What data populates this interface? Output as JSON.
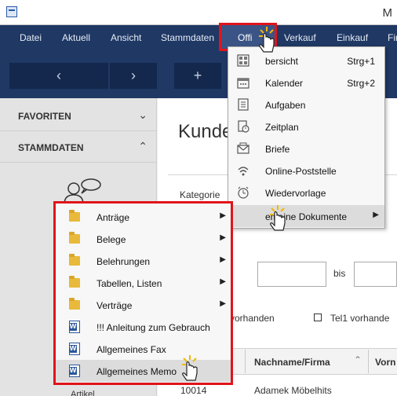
{
  "window": {
    "title": "M"
  },
  "menubar": {
    "items": [
      "Datei",
      "Aktuell",
      "Ansicht",
      "Stammdaten",
      "Office",
      "Verkauf",
      "Einkauf",
      "Fir"
    ],
    "office_label": "Offi"
  },
  "toolbar": {
    "back_glyph": "‹",
    "forward_glyph": "›",
    "add_glyph": "+"
  },
  "sidebar": {
    "favoriten": "FAVORITEN",
    "stammdaten": "STAMMDATEN",
    "artikel": "Artikel",
    "chevron_down": "⌄",
    "chevron_up": "⌃"
  },
  "main": {
    "title": "Kunde",
    "kategorie": "Kategorie",
    "bis": "bis",
    "vorhanden": "vorhanden",
    "tel1_label": "Tel1 vorhande",
    "columns": [
      "Nachname/Firma",
      "Vorn"
    ],
    "row1": {
      "id": "10014",
      "name": "Adamek Möbelhits"
    }
  },
  "office_menu": {
    "items": [
      {
        "label": "Übersicht",
        "shortcut": "Strg+1",
        "icon": "overview-icon"
      },
      {
        "label": "Kalender",
        "shortcut": "Strg+2",
        "icon": "calendar-icon"
      },
      {
        "label": "Aufgaben",
        "shortcut": "",
        "icon": "tasks-icon"
      },
      {
        "label": "Zeitplan",
        "shortcut": "",
        "icon": "schedule-icon"
      },
      {
        "label": "Briefe",
        "shortcut": "",
        "icon": "letter-icon"
      },
      {
        "label": "Online-Poststelle",
        "shortcut": "",
        "icon": "online-mail-icon"
      },
      {
        "label": "Wiedervorlage",
        "shortcut": "",
        "icon": "alarm-clock-icon"
      },
      {
        "label": "Allgemeine Dokumente",
        "shortcut": "",
        "icon": "documents-icon"
      }
    ],
    "overview_visible": "bersicht",
    "documents_visible": "emeine Dokumente"
  },
  "sub_menu": {
    "items": [
      {
        "label": "Anträge",
        "type": "folder",
        "submenu": true
      },
      {
        "label": "Belege",
        "type": "folder",
        "submenu": true
      },
      {
        "label": "Belehrungen",
        "type": "folder",
        "submenu": true
      },
      {
        "label": "Tabellen, Listen",
        "type": "folder",
        "submenu": true
      },
      {
        "label": "Verträge",
        "type": "folder",
        "submenu": true
      },
      {
        "label": "!!! Anleitung zum Gebrauch",
        "type": "word",
        "submenu": false
      },
      {
        "label": "Allgemeines Fax",
        "type": "word",
        "submenu": false
      },
      {
        "label": "Allgemeines Memo",
        "type": "word",
        "submenu": false
      }
    ],
    "memo_visible": "Allgemeines Memo"
  },
  "colors": {
    "menubar_bg": "#1f3864",
    "highlight_red": "#e0141b",
    "menu_bg": "#f7f7f7",
    "hover_bg": "#dcdcdc"
  }
}
